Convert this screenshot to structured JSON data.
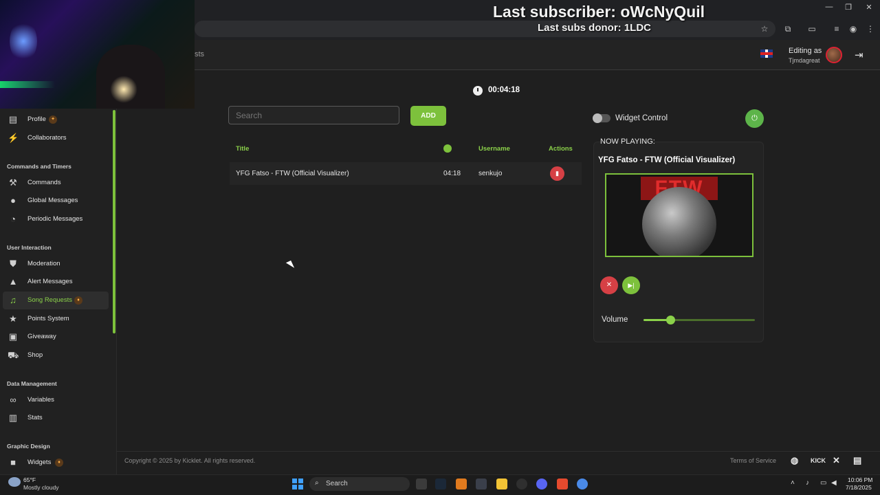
{
  "overlay": {
    "last_subscriber": "Last subscriber: oWcNyQuil",
    "last_subs_donor": "Last subs donor: 1LDC"
  },
  "header": {
    "partial_tab_text": "sts",
    "editing_as": "Editing as",
    "username": "Tjmdagreat"
  },
  "sidebar": {
    "items": [
      {
        "label": "Profile",
        "icon": "person-card-icon",
        "badge": "sparkle"
      },
      {
        "label": "Collaborators",
        "icon": "collaborators-icon"
      },
      {
        "label": "Commands",
        "icon": "commands-icon"
      },
      {
        "label": "Global Messages",
        "icon": "chat-bubble-icon"
      },
      {
        "label": "Periodic Messages",
        "icon": "clock-icon"
      },
      {
        "label": "Moderation",
        "icon": "shield-icon"
      },
      {
        "label": "Alert Messages",
        "icon": "warning-icon"
      },
      {
        "label": "Song Requests",
        "icon": "music-note-icon",
        "badge": "fire",
        "active": true
      },
      {
        "label": "Points System",
        "icon": "star-icon"
      },
      {
        "label": "Giveaway",
        "icon": "gift-icon"
      },
      {
        "label": "Shop",
        "icon": "cart-icon"
      },
      {
        "label": "Variables",
        "icon": "link-icon"
      },
      {
        "label": "Stats",
        "icon": "bar-chart-icon"
      },
      {
        "label": "Widgets",
        "icon": "video-camera-icon",
        "badge": "fire"
      }
    ],
    "sections": [
      "Commands and Timers",
      "User Interaction",
      "Data Management",
      "Graphic Design"
    ]
  },
  "main": {
    "timer": "00:04:18",
    "search_placeholder": "Search",
    "add_label": "ADD",
    "table": {
      "headers": {
        "title": "Title",
        "username": "Username",
        "actions": "Actions"
      },
      "rows": [
        {
          "title": "YFG Fatso - FTW (Official Visualizer)",
          "duration": "04:18",
          "username": "senkujo"
        }
      ]
    }
  },
  "widget": {
    "control_label": "Widget Control",
    "enabled": false,
    "now_playing_label": "NOW PLAYING:",
    "now_playing_title": "YFG Fatso - FTW (Official Visualizer)",
    "art_text": "FTW",
    "volume_label": "Volume",
    "volume_fraction": 0.24
  },
  "footer": {
    "copyright": "Copyright © 2025 by Kicklet. All rights reserved.",
    "terms": "Terms of Service",
    "kick_text": "KICK"
  },
  "taskbar": {
    "temperature": "65°F",
    "weather": "Mostly cloudy",
    "search": "Search",
    "time": "10:06 PM",
    "date": "7/18/2025"
  },
  "colors": {
    "accent_green": "#7dc13c",
    "danger_red": "#d64045",
    "background": "#1f1f1f"
  }
}
